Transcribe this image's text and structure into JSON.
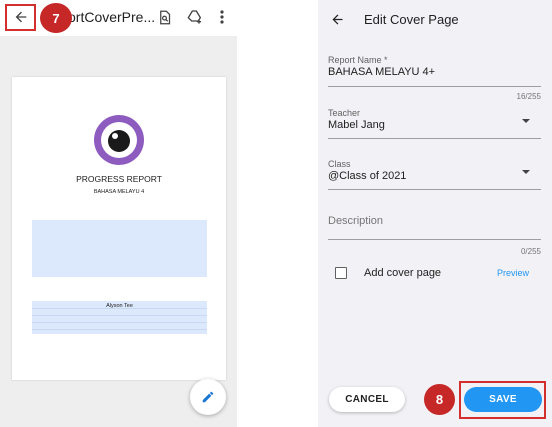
{
  "left": {
    "title": "ortCoverPre...",
    "step_badge": "7",
    "document": {
      "heading": "PROGRESS REPORT",
      "subheading": "BAHASA MELAYU 4",
      "student_name": "Alyson Tee"
    },
    "icons": [
      "back-arrow-icon",
      "search-in-document-icon",
      "add-to-drive-icon",
      "more-vert-icon",
      "edit-pencil-icon"
    ]
  },
  "right": {
    "title": "Edit Cover Page",
    "report_name": {
      "label": "Report Name *",
      "value": "BAHASA MELAYU 4+",
      "counter": "16/255"
    },
    "teacher": {
      "label": "Teacher",
      "value": "Mabel Jang"
    },
    "class": {
      "label": "Class",
      "value": "@Class of 2021"
    },
    "description": {
      "placeholder": "Description",
      "counter": "0/255"
    },
    "add_cover_page": {
      "label": "Add cover page",
      "checked": false,
      "preview": "Preview"
    },
    "cancel_label": "CANCEL",
    "save_label": "SAVE",
    "step_badge": "8"
  },
  "colors": {
    "accent_blue": "#2196f3",
    "badge_red": "#c62828",
    "highlight_border": "#d32f2f",
    "logo_purple": "#8e5bbf"
  }
}
